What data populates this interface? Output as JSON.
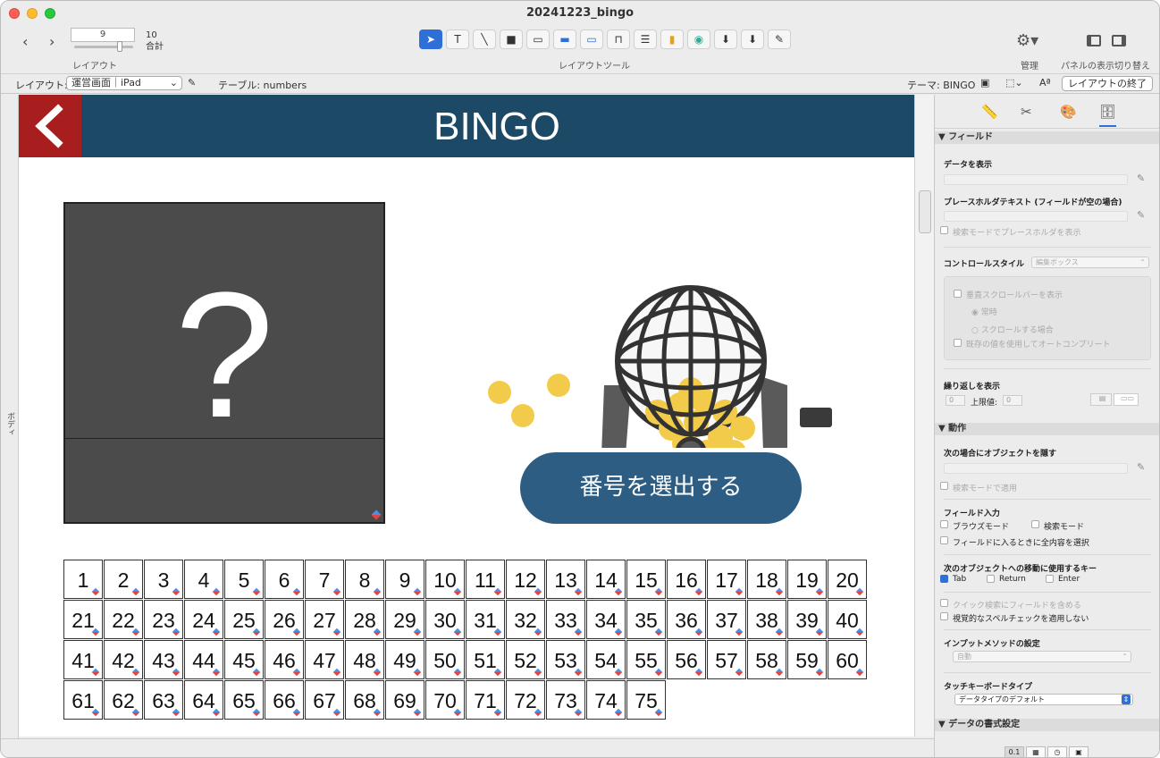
{
  "window": {
    "title": "20241223_bingo"
  },
  "toolbar": {
    "record_value": "9",
    "total_count": "10",
    "total_label": "合計",
    "layout_label": "レイアウト",
    "layout_tools_label": "レイアウトツール",
    "manage_label": "管理",
    "panel_toggle_label": "パネルの表示切り替え"
  },
  "layoutbar": {
    "layout_prefix": "レイアウト:",
    "layout_value": "運営画面｜iPad",
    "table_label": "テーブル: numbers",
    "theme_label": "テーマ: BINGO",
    "exit_button": "レイアウトの終了"
  },
  "side_label": "ボディ",
  "canvas": {
    "header_title": "BINGO",
    "back_glyph": "<",
    "question_mark": "?",
    "draw_button": "番号を選出する",
    "numbers": [
      1,
      2,
      3,
      4,
      5,
      6,
      7,
      8,
      9,
      10,
      11,
      12,
      13,
      14,
      15,
      16,
      17,
      18,
      19,
      20,
      21,
      22,
      23,
      24,
      25,
      26,
      27,
      28,
      29,
      30,
      31,
      32,
      33,
      34,
      35,
      36,
      37,
      38,
      39,
      40,
      41,
      42,
      43,
      44,
      45,
      46,
      47,
      48,
      49,
      50,
      51,
      52,
      53,
      54,
      55,
      56,
      57,
      58,
      59,
      60,
      61,
      62,
      63,
      64,
      65,
      66,
      67,
      68,
      69,
      70,
      71,
      72,
      73,
      74,
      75
    ]
  },
  "inspector": {
    "field_section": "▼ フィールド",
    "show_data": "データを表示",
    "placeholder_text": "プレースホルダテキスト (フィールドが空の場合)",
    "show_placeholder_find": "検索モードでプレースホルダを表示",
    "control_style": "コントロールスタイル",
    "control_style_value": "編集ボックス",
    "vertical_scroll": "垂直スクロールバーを表示",
    "always": "常時",
    "when_scrolling": "スクロールする場合",
    "autocomplete": "既存の値を使用してオートコンプリート",
    "repeat_show": "繰り返しを表示",
    "repeat_from": "0",
    "upper_limit_label": "上限値:",
    "upper_limit": "0",
    "behavior_section": "▼ 動作",
    "hide_object_when": "次の場合にオブジェクトを隠す",
    "apply_in_find": "検索モードで適用",
    "field_entry": "フィールド入力",
    "browse_mode": "ブラウズモード",
    "find_mode": "検索モード",
    "select_all_on_entry": "フィールドに入るときに全内容を選択",
    "next_object_key": "次のオブジェクトへの移動に使用するキー",
    "tab": "Tab",
    "return": "Return",
    "enter": "Enter",
    "quick_find": "クイック検索にフィールドを含める",
    "spellcheck": "視覚的なスペルチェックを適用しない",
    "input_method": "インプットメソッドの設定",
    "input_method_value": "自動",
    "touch_keyboard": "タッチキーボードタイプ",
    "touch_keyboard_value": "データタイプのデフォルト",
    "data_format_section": "▼ データの書式設定",
    "format_tab_number": "0.1"
  },
  "colors": {
    "header_bg": "#1c4a66",
    "back_bg": "#a81e1e",
    "draw_button_bg": "#2d5d82",
    "question_box_bg": "#4b4b4b"
  }
}
